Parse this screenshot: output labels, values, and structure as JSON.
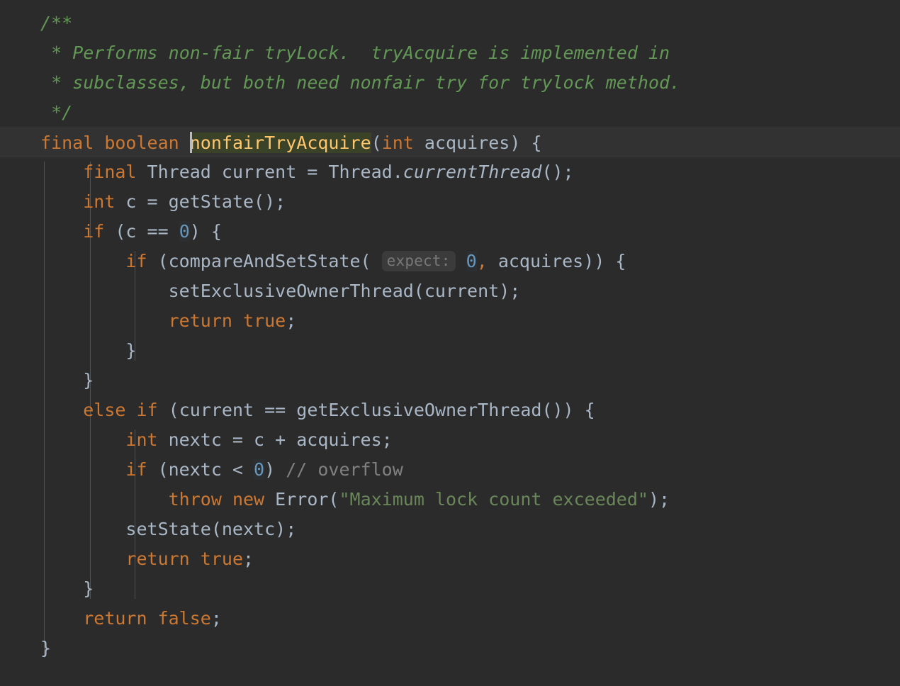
{
  "editor": {
    "language": "java",
    "theme": "darcula",
    "background_color": "#2b2b2b",
    "current_line_color": "#323232",
    "caret_color": "#bbbbbb",
    "identifier_highlight_color": "#3a4227",
    "colors": {
      "keyword": "#cc7832",
      "default_text": "#a9b7c6",
      "number": "#6897bb",
      "string": "#6a8759",
      "javadoc_comment": "#629755",
      "line_comment": "#808080",
      "method_declaration": "#ffc66d",
      "indent_guide": "#4f5355",
      "param_hint_text": "#787878",
      "param_hint_background": "#3b3b3b"
    }
  },
  "code": {
    "javadoc": {
      "open": "/**",
      "line1_star": "*",
      "line1_text": "Performs non-fair tryLock.  tryAcquire is implemented in",
      "line2_star": "*",
      "line2_text": "subclasses, but both need nonfair try for trylock method.",
      "close": "*/"
    },
    "signature": {
      "mod_final": "final",
      "type_boolean": "boolean",
      "method_name": "nonfairTryAcquire",
      "paren_open": "(",
      "param_type": "int",
      "param_name": "acquires",
      "paren_close": ")",
      "brace_open": "{"
    },
    "body": {
      "l1_final": "final",
      "l1_rest": " Thread current = Thread.",
      "l1_static": "currentThread",
      "l1_tail": "();",
      "l2_int": "int",
      "l2_rest": " c = getState();",
      "l3_if": "if",
      "l3_mid": " (c == ",
      "l3_num": "0",
      "l3_tail": ") {",
      "l4_if": "if",
      "l4_mid": " (compareAndSetState(",
      "l4_hint": "expect:",
      "l4_num": "0",
      "l4_comma": ",",
      "l4_tail": " acquires)) {",
      "l5": "setExclusiveOwnerThread(current);",
      "l6_return": "return",
      "l6_true": " true",
      "l6_semi": ";",
      "l7_brace": "}",
      "l8_brace": "}",
      "l9_else": "else",
      "l9_if": "if",
      "l9_tail": " (current == getExclusiveOwnerThread()) {",
      "l10_int": "int",
      "l10_rest": " nextc = c + acquires;",
      "l11_if": "if",
      "l11_mid": " (nextc < ",
      "l11_num": "0",
      "l11_close": ") ",
      "l11_comment": "// overflow",
      "l12_throw": "throw",
      "l12_new": "new",
      "l12_error": " Error(",
      "l12_string": "\"Maximum lock count exceeded\"",
      "l12_tail": ");",
      "l13": "setState(nextc);",
      "l14_return": "return",
      "l14_true": " true",
      "l14_semi": ";",
      "l15_brace": "}",
      "l16_return": "return",
      "l16_false": " false",
      "l16_semi": ";",
      "l17_brace": "}"
    }
  }
}
